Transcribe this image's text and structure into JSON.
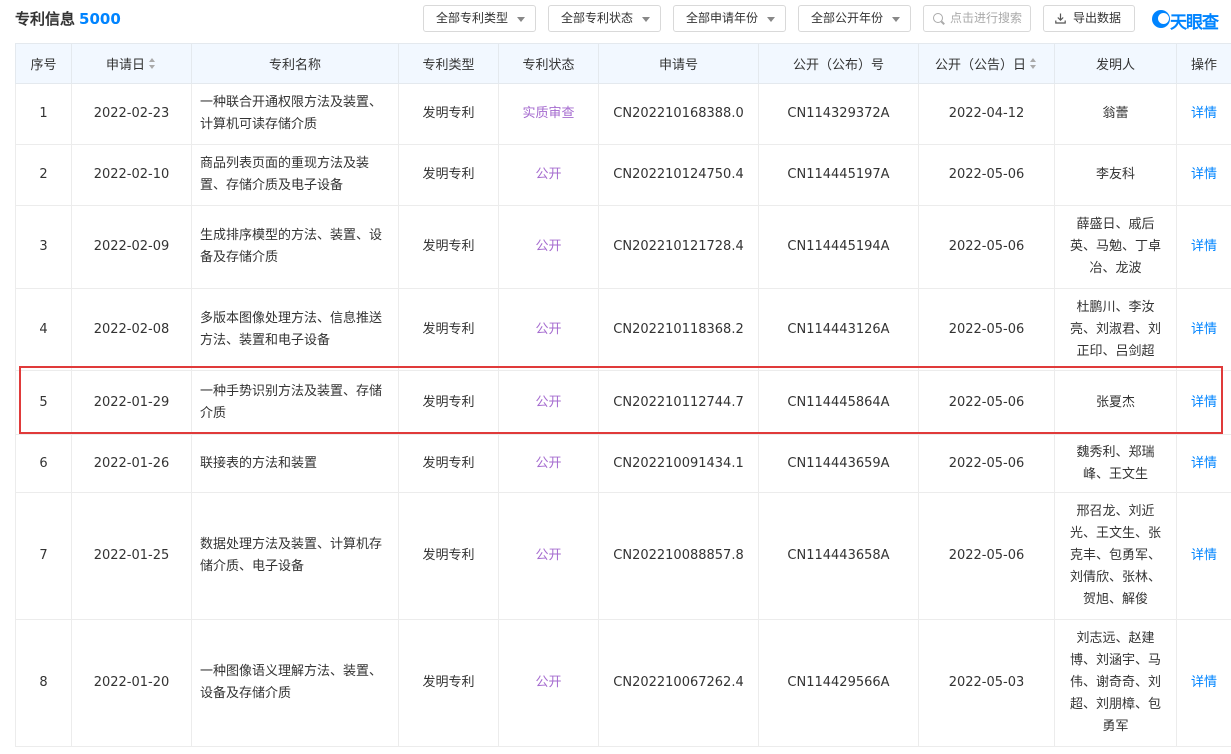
{
  "header": {
    "title": "专利信息",
    "count": "5000",
    "filters": [
      {
        "label": "全部专利类型"
      },
      {
        "label": "全部专利状态"
      },
      {
        "label": "全部申请年份"
      },
      {
        "label": "全部公开年份"
      }
    ],
    "search_placeholder": "点击进行搜索",
    "export_label": "导出数据",
    "logo_text": "天眼查",
    "icons": {
      "search": "search-icon",
      "export": "download-icon",
      "logo": "tianyancha-logo"
    }
  },
  "table": {
    "columns": [
      {
        "label": "序号",
        "sortable": false
      },
      {
        "label": "申请日",
        "sortable": true
      },
      {
        "label": "专利名称",
        "sortable": false
      },
      {
        "label": "专利类型",
        "sortable": false
      },
      {
        "label": "专利状态",
        "sortable": false
      },
      {
        "label": "申请号",
        "sortable": false
      },
      {
        "label": "公开（公布）号",
        "sortable": false
      },
      {
        "label": "公开（公告）日",
        "sortable": true
      },
      {
        "label": "发明人",
        "sortable": false
      },
      {
        "label": "操作",
        "sortable": false
      }
    ],
    "rows": [
      {
        "no": "1",
        "date": "2022-02-23",
        "name": "一种联合开通权限方法及装置、计算机可读存储介质",
        "type": "发明专利",
        "status": "实质审查",
        "app_no": "CN202210168388.0",
        "pub_no": "CN114329372A",
        "pub_date": "2022-04-12",
        "inventors": "翁蕾",
        "action": "详情"
      },
      {
        "no": "2",
        "date": "2022-02-10",
        "name": "商品列表页面的重现方法及装置、存储介质及电子设备",
        "type": "发明专利",
        "status": "公开",
        "app_no": "CN202210124750.4",
        "pub_no": "CN114445197A",
        "pub_date": "2022-05-06",
        "inventors": "李友科",
        "action": "详情"
      },
      {
        "no": "3",
        "date": "2022-02-09",
        "name": "生成排序模型的方法、装置、设备及存储介质",
        "type": "发明专利",
        "status": "公开",
        "app_no": "CN202210121728.4",
        "pub_no": "CN114445194A",
        "pub_date": "2022-05-06",
        "inventors": "薛盛日、戚后英、马勉、丁卓冶、龙波",
        "action": "详情"
      },
      {
        "no": "4",
        "date": "2022-02-08",
        "name": "多版本图像处理方法、信息推送方法、装置和电子设备",
        "type": "发明专利",
        "status": "公开",
        "app_no": "CN202210118368.2",
        "pub_no": "CN114443126A",
        "pub_date": "2022-05-06",
        "inventors": "杜鹏川、李汝亮、刘淑君、刘正印、吕剑超",
        "action": "详情"
      },
      {
        "no": "5",
        "date": "2022-01-29",
        "name": "一种手势识别方法及装置、存储介质",
        "type": "发明专利",
        "status": "公开",
        "app_no": "CN202210112744.7",
        "pub_no": "CN114445864A",
        "pub_date": "2022-05-06",
        "inventors": "张夏杰",
        "action": "详情"
      },
      {
        "no": "6",
        "date": "2022-01-26",
        "name": "联接表的方法和装置",
        "type": "发明专利",
        "status": "公开",
        "app_no": "CN202210091434.1",
        "pub_no": "CN114443659A",
        "pub_date": "2022-05-06",
        "inventors": "魏秀利、郑瑞峰、王文生",
        "action": "详情"
      },
      {
        "no": "7",
        "date": "2022-01-25",
        "name": "数据处理方法及装置、计算机存储介质、电子设备",
        "type": "发明专利",
        "status": "公开",
        "app_no": "CN202210088857.8",
        "pub_no": "CN114443658A",
        "pub_date": "2022-05-06",
        "inventors": "邢召龙、刘近光、王文生、张克丰、包勇军、刘倩欣、张林、贺旭、解俊",
        "action": "详情"
      },
      {
        "no": "8",
        "date": "2022-01-20",
        "name": "一种图像语义理解方法、装置、设备及存储介质",
        "type": "发明专利",
        "status": "公开",
        "app_no": "CN202210067262.4",
        "pub_no": "CN114429566A",
        "pub_date": "2022-05-03",
        "inventors": "刘志远、赵建博、刘涵宇、马伟、谢奇奇、刘超、刘朋樟、包勇军",
        "action": "详情"
      }
    ]
  }
}
